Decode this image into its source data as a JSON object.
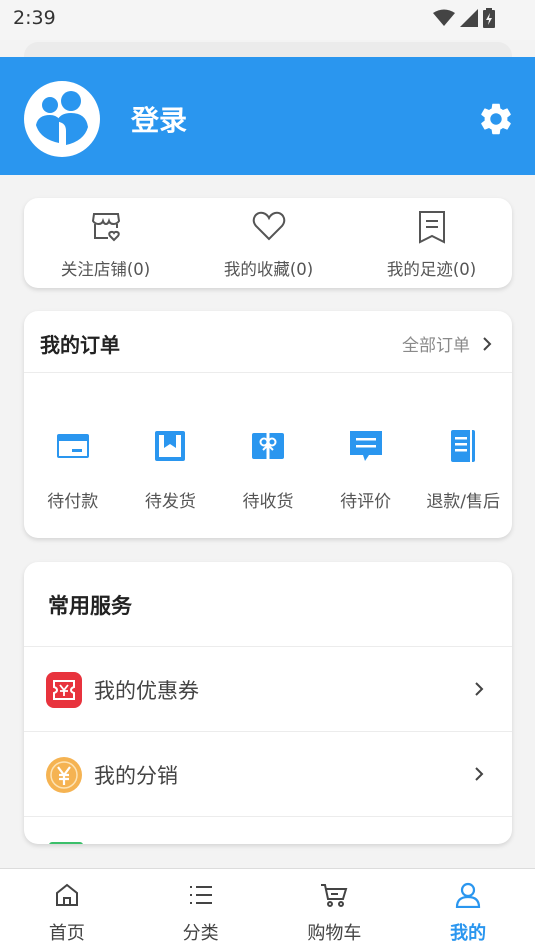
{
  "status_bar": {
    "time": "2:39"
  },
  "header": {
    "login": "登录"
  },
  "quick_links": [
    {
      "label": "关注店铺(0)",
      "icon": "store-heart-icon"
    },
    {
      "label": "我的收藏(0)",
      "icon": "heart-icon"
    },
    {
      "label": "我的足迹(0)",
      "icon": "receipt-icon"
    }
  ],
  "orders": {
    "title": "我的订单",
    "all_label": "全部订单",
    "items": [
      {
        "label": "待付款",
        "icon": "wallet-icon"
      },
      {
        "label": "待发货",
        "icon": "bookmark-box-icon"
      },
      {
        "label": "待收货",
        "icon": "gift-icon"
      },
      {
        "label": "待评价",
        "icon": "comment-icon"
      },
      {
        "label": "退款/售后",
        "icon": "document-icon"
      }
    ]
  },
  "services": {
    "title": "常用服务",
    "items": [
      {
        "label": "我的优惠券",
        "icon": "coupon-icon",
        "color": "#e8333d"
      },
      {
        "label": "我的分销",
        "icon": "yen-coin-icon",
        "color": "#f5b352"
      }
    ]
  },
  "tabbar": [
    {
      "label": "首页",
      "icon": "home-icon",
      "active": false
    },
    {
      "label": "分类",
      "icon": "list-icon",
      "active": false
    },
    {
      "label": "购物车",
      "icon": "cart-icon",
      "active": false
    },
    {
      "label": "我的",
      "icon": "person-icon",
      "active": true
    }
  ],
  "colors": {
    "brand": "#2a96ef",
    "header": "#2a96ef"
  }
}
